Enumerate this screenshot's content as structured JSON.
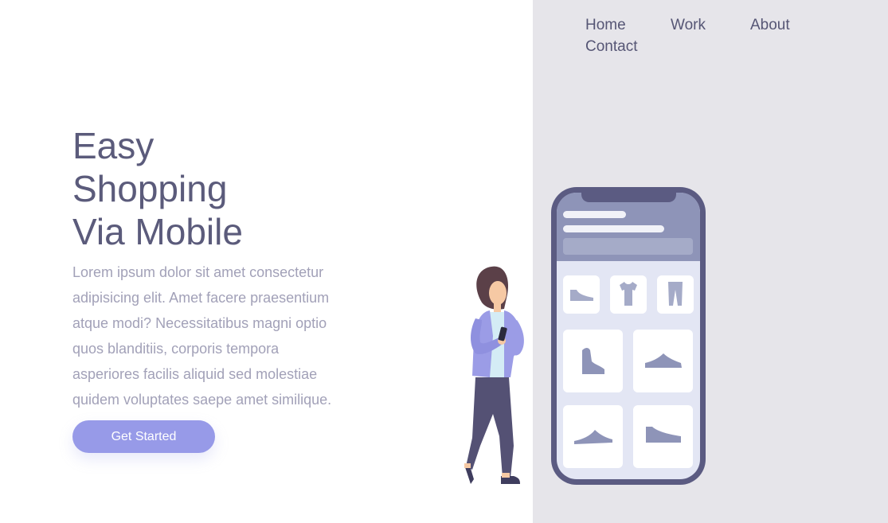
{
  "nav": {
    "items": [
      {
        "label": "Home"
      },
      {
        "label": "Work"
      },
      {
        "label": "About"
      },
      {
        "label": "Contact"
      }
    ]
  },
  "hero": {
    "title_lines": [
      "Easy",
      "Shopping",
      "Via Mobile"
    ],
    "description_lines": [
      "Lorem ipsum dolor sit amet consectetur",
      "adipisicing elit. Amet facere praesentium",
      "atque modi? Necessitatibus magni optio",
      "quos blanditiis, corporis tempora",
      "asperiores facilis aliquid sed molestiae",
      "quidem voluptates saepe amet similique."
    ],
    "cta_label": "Get Started"
  },
  "colors": {
    "accent": "#979ae8",
    "heading": "#5b5b7b",
    "body_text": "#a2a1b8",
    "panel_bg": "#e6e5ea",
    "phone_frame": "#5b5b82"
  },
  "illustration": {
    "icons": [
      "person-icon",
      "smartphone-icon",
      "sneaker-icon",
      "tshirt-icon",
      "pants-icon",
      "boot-icon",
      "shoe-icon"
    ]
  }
}
